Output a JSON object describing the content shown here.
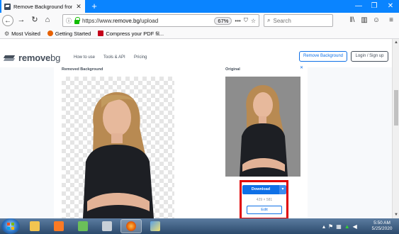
{
  "browser": {
    "tab_title": "Remove Background from Imé",
    "url_prefix": "https://www.",
    "url_domain": "remove.bg",
    "url_path": "/upload",
    "zoom": "67%",
    "more_dots": "•••",
    "search_placeholder": "Search"
  },
  "bookmarks": [
    {
      "label": "Most Visited",
      "color": "#555555"
    },
    {
      "label": "Getting Started",
      "color": "#e66000"
    },
    {
      "label": "Compress your PDF fil...",
      "color": "#c4001a"
    }
  ],
  "site": {
    "logo_bold": "remove",
    "logo_light": "bg",
    "nav": [
      "How to use",
      "Tools & API",
      "Pricing"
    ],
    "remove_background": "Remove Background",
    "login": "Login / Sign up"
  },
  "content": {
    "removed_label": "Removed Background",
    "original_label": "Original",
    "ad_close": "✕",
    "download": "Download",
    "download_caret": "▾",
    "dimensions": "429 × 581",
    "edit": "Edit"
  },
  "taskbar": {
    "time": "5:50 AM",
    "date": "5/25/2020"
  },
  "colors": {
    "accent": "#0f70e6",
    "firefox_tabbar": "#0a84ff",
    "highlight": "#e00000"
  }
}
